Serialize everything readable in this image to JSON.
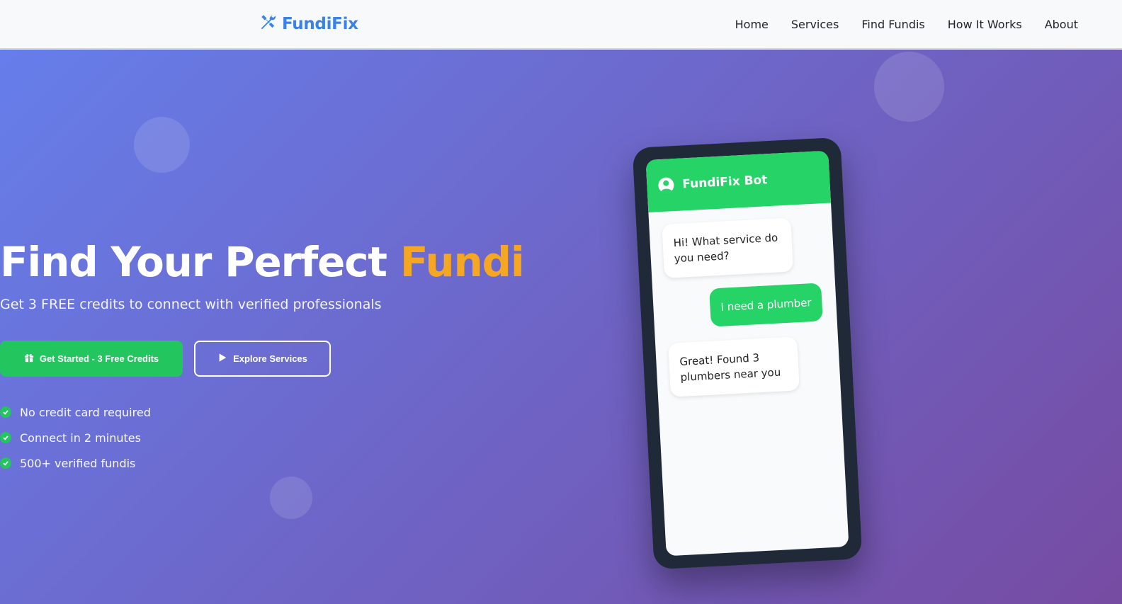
{
  "nav": {
    "brand": "FundiFix",
    "links": [
      "Home",
      "Services",
      "Find Fundis",
      "How It Works",
      "About"
    ]
  },
  "hero": {
    "title_main": "Find Your Perfect ",
    "title_accent": "Fundi",
    "subtitle": "Get 3 FREE credits to connect with verified professionals",
    "primary_button": "Get Started - 3 Free Credits",
    "secondary_button": "Explore Services",
    "features": [
      "No credit card required",
      "Connect in 2 minutes",
      "500+ verified fundis"
    ]
  },
  "phone": {
    "bot_name": "FundiFix Bot",
    "messages": [
      {
        "from": "bot",
        "text": "Hi! What service do you need?"
      },
      {
        "from": "user",
        "text": "I need a plumber"
      },
      {
        "from": "bot",
        "text": "Great! Found 3 plumbers near you"
      }
    ]
  },
  "colors": {
    "brand": "#3b82e6",
    "accent": "#f5a623",
    "primary_green": "#22c55e",
    "chat_green": "#25d366",
    "gradient_start": "#667eea",
    "gradient_end": "#764ba2"
  }
}
